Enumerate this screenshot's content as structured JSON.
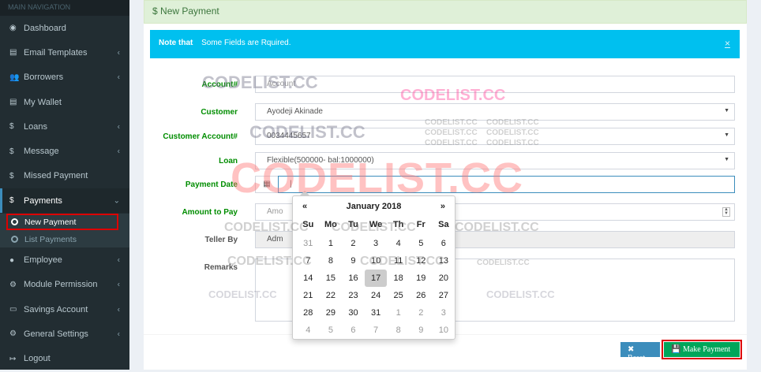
{
  "sidebar": {
    "header": "MAIN NAVIGATION",
    "items": [
      {
        "label": "Dashboard",
        "icon": "dashboard-icon",
        "glyph": "◉",
        "has_children": false
      },
      {
        "label": "Email Templates",
        "icon": "book-icon",
        "glyph": "▤",
        "has_children": true
      },
      {
        "label": "Borrowers",
        "icon": "users-icon",
        "glyph": "👥",
        "has_children": true
      },
      {
        "label": "My Wallet",
        "icon": "book-icon",
        "glyph": "▤",
        "has_children": false
      },
      {
        "label": "Loans",
        "icon": "dollar-icon",
        "glyph": "$",
        "has_children": true
      },
      {
        "label": "Message",
        "icon": "dollar-icon",
        "glyph": "$",
        "has_children": true
      },
      {
        "label": "Missed Payment",
        "icon": "dollar-icon",
        "glyph": "$",
        "has_children": false
      },
      {
        "label": "Payments",
        "icon": "dollar-icon",
        "glyph": "$",
        "has_children": true
      }
    ],
    "payments_sub": [
      {
        "label": "New Payment"
      },
      {
        "label": "List Payments"
      }
    ],
    "items_after": [
      {
        "label": "Employee",
        "icon": "user-icon",
        "glyph": "●",
        "has_children": true
      },
      {
        "label": "Module Permission",
        "icon": "cogs-icon",
        "glyph": "⚙",
        "has_children": true
      },
      {
        "label": "Savings Account",
        "icon": "money-icon",
        "glyph": "▭",
        "has_children": true
      },
      {
        "label": "General Settings",
        "icon": "gear-icon",
        "glyph": "⚙",
        "has_children": true
      },
      {
        "label": "Logout",
        "icon": "logout-icon",
        "glyph": "↦",
        "has_children": false
      }
    ]
  },
  "page": {
    "title_icon": "$",
    "title": "New Payment",
    "alert": {
      "strong": "Note that",
      "text": "Some Fields are Rquired.",
      "close": "×"
    }
  },
  "form": {
    "account": {
      "label": "Account#",
      "placeholder": "Account"
    },
    "customer": {
      "label": "Customer",
      "value": "Ayodeji Akinade"
    },
    "customer_account": {
      "label": "Customer Account#",
      "value": "0034445657"
    },
    "loan": {
      "label": "Loan",
      "value": "Flexible(500000- bal:1000000)"
    },
    "payment_date": {
      "label": "Payment Date",
      "value": "|",
      "icon": "calendar-icon",
      "glyph": "▦"
    },
    "amount": {
      "label": "Amount to Pay",
      "placeholder": "Amo"
    },
    "teller": {
      "label": "Teller By",
      "value": "Adm"
    },
    "remarks": {
      "label": "Remarks"
    }
  },
  "buttons": {
    "reset": {
      "label": "✖ Reset"
    },
    "pay": {
      "label": "💾 Make Payment"
    }
  },
  "datepicker": {
    "prev": "«",
    "title": "January 2018",
    "next": "»",
    "weekdays": [
      "Su",
      "Mo",
      "Tu",
      "We",
      "Th",
      "Fr",
      "Sa"
    ],
    "days": [
      [
        "31",
        "muted"
      ],
      [
        "1",
        ""
      ],
      [
        "2",
        ""
      ],
      [
        "3",
        ""
      ],
      [
        "4",
        ""
      ],
      [
        "5",
        ""
      ],
      [
        "6",
        ""
      ],
      [
        "7",
        ""
      ],
      [
        "8",
        ""
      ],
      [
        "9",
        ""
      ],
      [
        "10",
        ""
      ],
      [
        "11",
        ""
      ],
      [
        "12",
        ""
      ],
      [
        "13",
        ""
      ],
      [
        "14",
        ""
      ],
      [
        "15",
        ""
      ],
      [
        "16",
        ""
      ],
      [
        "17",
        "today"
      ],
      [
        "18",
        ""
      ],
      [
        "19",
        ""
      ],
      [
        "20",
        ""
      ],
      [
        "21",
        ""
      ],
      [
        "22",
        ""
      ],
      [
        "23",
        ""
      ],
      [
        "24",
        ""
      ],
      [
        "25",
        ""
      ],
      [
        "26",
        ""
      ],
      [
        "27",
        ""
      ],
      [
        "28",
        ""
      ],
      [
        "29",
        ""
      ],
      [
        "30",
        ""
      ],
      [
        "31",
        ""
      ],
      [
        "1",
        "muted"
      ],
      [
        "2",
        "muted"
      ],
      [
        "3",
        "muted"
      ],
      [
        "4",
        "muted"
      ],
      [
        "5",
        "muted"
      ],
      [
        "6",
        "muted"
      ],
      [
        "7",
        "muted"
      ],
      [
        "8",
        "muted"
      ],
      [
        "9",
        "muted"
      ],
      [
        "10",
        "muted"
      ]
    ]
  },
  "watermark": "CODELIST.CC"
}
